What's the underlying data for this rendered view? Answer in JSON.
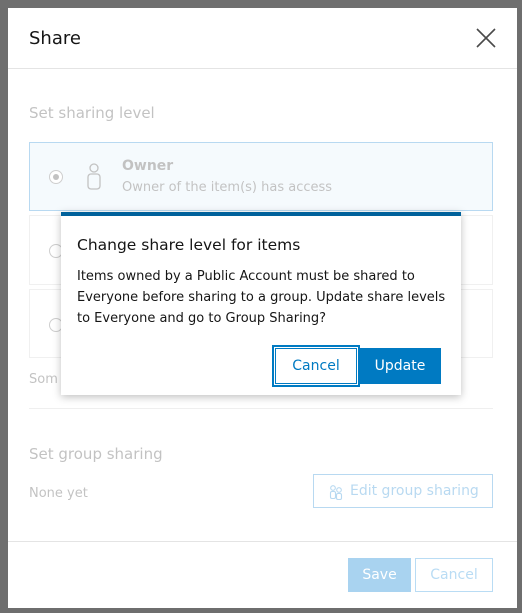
{
  "background_page": {
    "partial_text": ""
  },
  "dialog": {
    "title": "Share",
    "close_icon": "close-icon",
    "sharing_level": {
      "label": "Set sharing level",
      "options": [
        {
          "name": "Owner",
          "description": "Owner of the item(s) has access",
          "selected": true,
          "icon": "user-icon"
        },
        {
          "name": "",
          "description": "",
          "selected": false
        },
        {
          "name": "",
          "description": "",
          "selected": false
        }
      ],
      "note": "Som"
    },
    "group_sharing": {
      "label": "Set group sharing",
      "value": "None yet",
      "edit_button": "Edit group sharing",
      "edit_icon": "group-icon"
    },
    "footer": {
      "save_label": "Save",
      "cancel_label": "Cancel"
    }
  },
  "modal": {
    "title": "Change share level for items",
    "message": "Items owned by a Public Account must be shared to Everyone before sharing to a group. Update share levels to Everyone and go to Group Sharing?",
    "cancel_label": "Cancel",
    "update_label": "Update"
  },
  "colors": {
    "accent": "#007ac2",
    "modal_top_border": "#00619b",
    "selected_card_bg": "#e3f1fb",
    "overlay": "#6e6e6e"
  }
}
